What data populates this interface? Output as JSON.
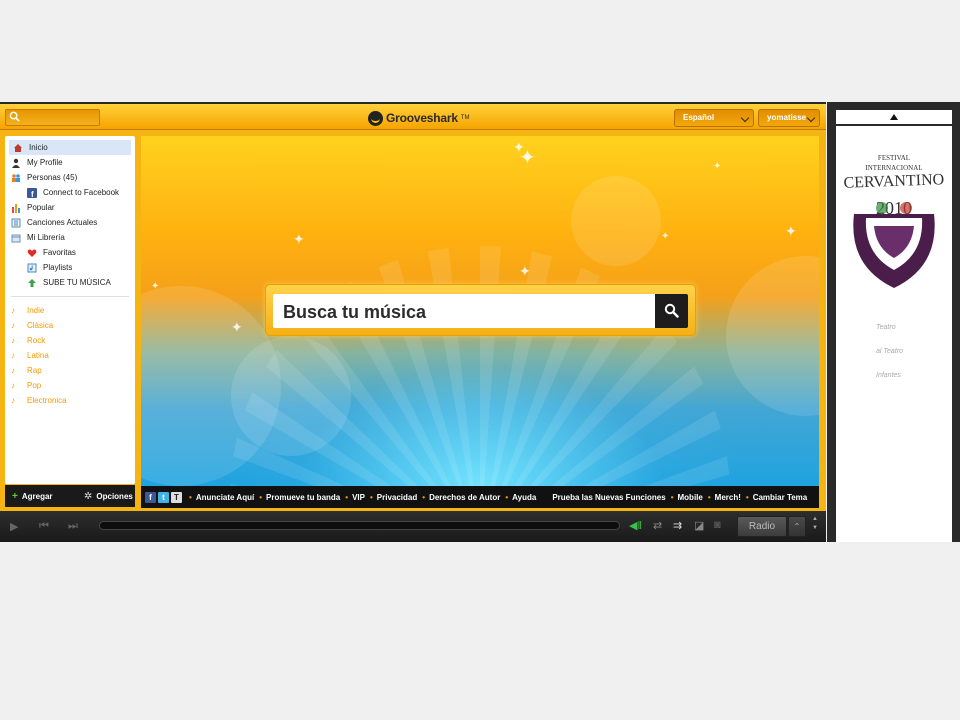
{
  "topbar": {
    "brand": "Grooveshark",
    "brand_tm": "TM",
    "language": "Español",
    "user": "yomatisse"
  },
  "sidebar": {
    "items": [
      {
        "label": "Inicio",
        "icon": "home-icon"
      },
      {
        "label": "My Profile",
        "icon": "user-icon"
      },
      {
        "label": "Personas (45)",
        "icon": "people-icon"
      },
      {
        "label": "Connect to Facebook",
        "icon": "facebook-icon"
      },
      {
        "label": "Popular",
        "icon": "chart-icon"
      },
      {
        "label": "Canciones Actuales",
        "icon": "note-list-icon"
      },
      {
        "label": "Mi Librería",
        "icon": "library-icon"
      },
      {
        "label": "Favoritas",
        "icon": "heart-icon"
      },
      {
        "label": "Playlists",
        "icon": "playlist-icon"
      },
      {
        "label": "SUBE TU MÚSICA",
        "icon": "upload-arrow-icon"
      }
    ],
    "genres": [
      "Indie",
      "Clásica",
      "Rock",
      "Latina",
      "Rap",
      "Pop",
      "Electronica"
    ],
    "footer": {
      "add": "Agregar",
      "options": "Opciones"
    }
  },
  "hero": {
    "search_placeholder": "Busca tu música"
  },
  "footer_links": [
    "Anunciate Aquí",
    "Promueve tu banda",
    "VIP",
    "Privacidad",
    "Derechos de Autor",
    "Ayuda",
    "Prueba las Nuevas Funciones",
    "Mobile",
    "Merch!",
    "Cambiar Tema"
  ],
  "player": {
    "radio_label": "Radio"
  },
  "ad": {
    "lines": [
      "Teatro",
      "al Teatro",
      "Infantes"
    ]
  },
  "colors": {
    "accent": "#f6b412",
    "genre": "#f59a00",
    "dark": "#1a1a1a",
    "link_dot": "#f59a00"
  }
}
